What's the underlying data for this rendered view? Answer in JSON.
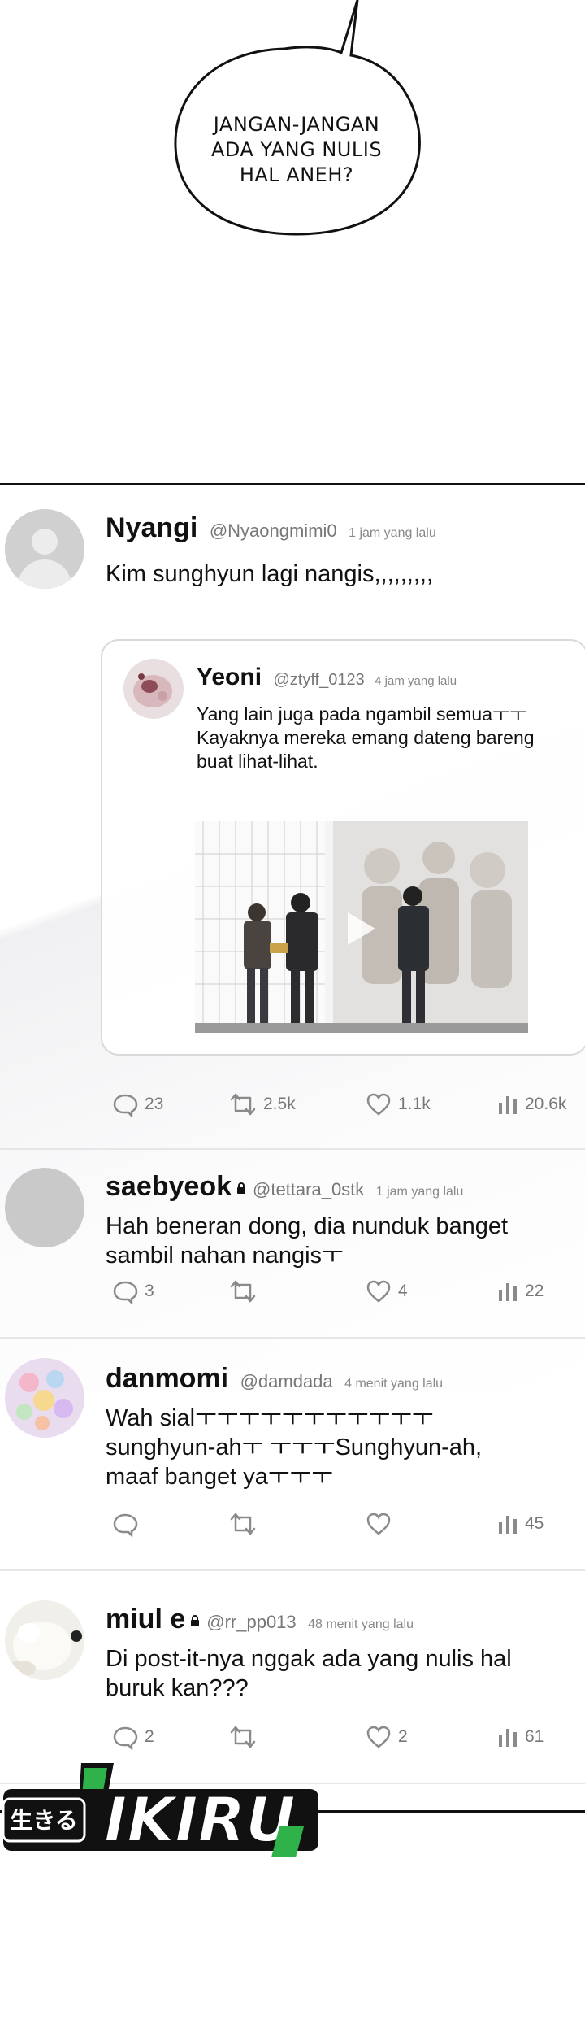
{
  "bubble": {
    "lines": [
      "JANGAN-JANGAN",
      "ADA YANG NULIS",
      "HAL ANEH?"
    ]
  },
  "main_post": {
    "name": "Nyangi",
    "handle": "@Nyaongmimi0",
    "time": "1 jam yang lalu",
    "text": "Kim sunghyun lagi nangis,,,,,,,,,",
    "quote": {
      "name": "Yeoni",
      "handle": "@ztyff_0123",
      "time": "4 jam yang lalu",
      "lines": [
        "Yang lain juga pada ngambil semuaㅜㅜ",
        "Kayaknya mereka emang dateng bareng",
        "buat lihat-lihat."
      ]
    },
    "stats": {
      "replies": "23",
      "reposts": "2.5k",
      "likes": "1.1k",
      "views": "20.6k"
    }
  },
  "replies": [
    {
      "name": "saebyeok",
      "locked": true,
      "handle": "@tettara_0stk",
      "time": "1 jam yang lalu",
      "lines": [
        "Hah beneran dong, dia nunduk banget",
        "sambil nahan nangisㅜ"
      ],
      "stats": {
        "replies": "3",
        "reposts": "",
        "likes": "4",
        "views": "22"
      }
    },
    {
      "name": "danmomi",
      "locked": false,
      "handle": "@damdada",
      "time": "4 menit yang lalu",
      "lines": [
        "Wah sialㅜㅜㅜㅜㅜㅜㅜㅜㅜㅜㅜ",
        "sunghyun-ahㅜ  ㅜㅜㅜSunghyun-ah,",
        "maaf banget yaㅜㅜㅜ"
      ],
      "stats": {
        "replies": "",
        "reposts": "",
        "likes": "",
        "views": "45"
      }
    },
    {
      "name": "miul e",
      "locked": true,
      "handle": "@rr_pp013",
      "time": "48 menit yang lalu",
      "lines": [
        "Di post-it-nya nggak ada yang nulis hal",
        "buruk kan???"
      ],
      "stats": {
        "replies": "2",
        "reposts": "",
        "likes": "2",
        "views": "61"
      }
    }
  ],
  "watermark": {
    "kanji": "生きる",
    "word": "IKIRU"
  },
  "colors": {
    "text": "#111111",
    "muted": "#777777",
    "logo_green": "#2fb24a",
    "divider": "#111111"
  },
  "icons": [
    "reply-icon",
    "repost-icon",
    "like-icon",
    "views-icon",
    "lock-icon",
    "play-icon"
  ]
}
